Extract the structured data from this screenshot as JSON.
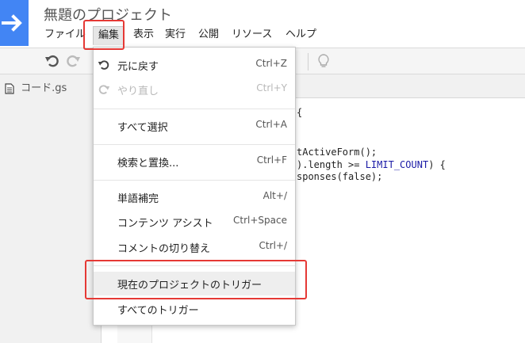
{
  "project": {
    "title": "無題のプロジェクト"
  },
  "menubar": {
    "file": "ファイル",
    "edit": "編集",
    "view": "表示",
    "run": "実行",
    "publish": "公開",
    "resources": "リソース",
    "help": "ヘルプ"
  },
  "sidebar": {
    "file_name": "コード.gs"
  },
  "code": {
    "line1": "{",
    "line2": "tActiveForm();",
    "line3_a": ").length >= ",
    "line3_const": "LIMIT_COUNT",
    "line3_b": ") {",
    "line4": "sponses(false);"
  },
  "edit_menu": {
    "undo": {
      "label": "元に戻す",
      "shortcut": "Ctrl+Z"
    },
    "redo": {
      "label": "やり直し",
      "shortcut": "Ctrl+Y"
    },
    "select_all": {
      "label": "すべて選択",
      "shortcut": "Ctrl+A"
    },
    "find_replace": {
      "label": "検索と置換...",
      "shortcut": "Ctrl+F"
    },
    "word_complete": {
      "label": "単語補完",
      "shortcut": "Alt+/"
    },
    "content_assist": {
      "label": "コンテンツ アシスト",
      "shortcut": "Ctrl+Space"
    },
    "toggle_comment": {
      "label": "コメントの切り替え",
      "shortcut": "Ctrl+/"
    },
    "current_triggers": {
      "label": "現在のプロジェクトのトリガー"
    },
    "all_triggers": {
      "label": "すべてのトリガー"
    }
  },
  "colors": {
    "logo": "#4285f4",
    "annotation": "#e53935",
    "hover": "#eeeeee",
    "keyword": "#1a1aa6"
  },
  "icons": {
    "logo": "arrow-right-icon",
    "undo": "undo-icon",
    "redo": "redo-icon",
    "lightbulb": "lightbulb-icon",
    "file": "document-icon"
  }
}
